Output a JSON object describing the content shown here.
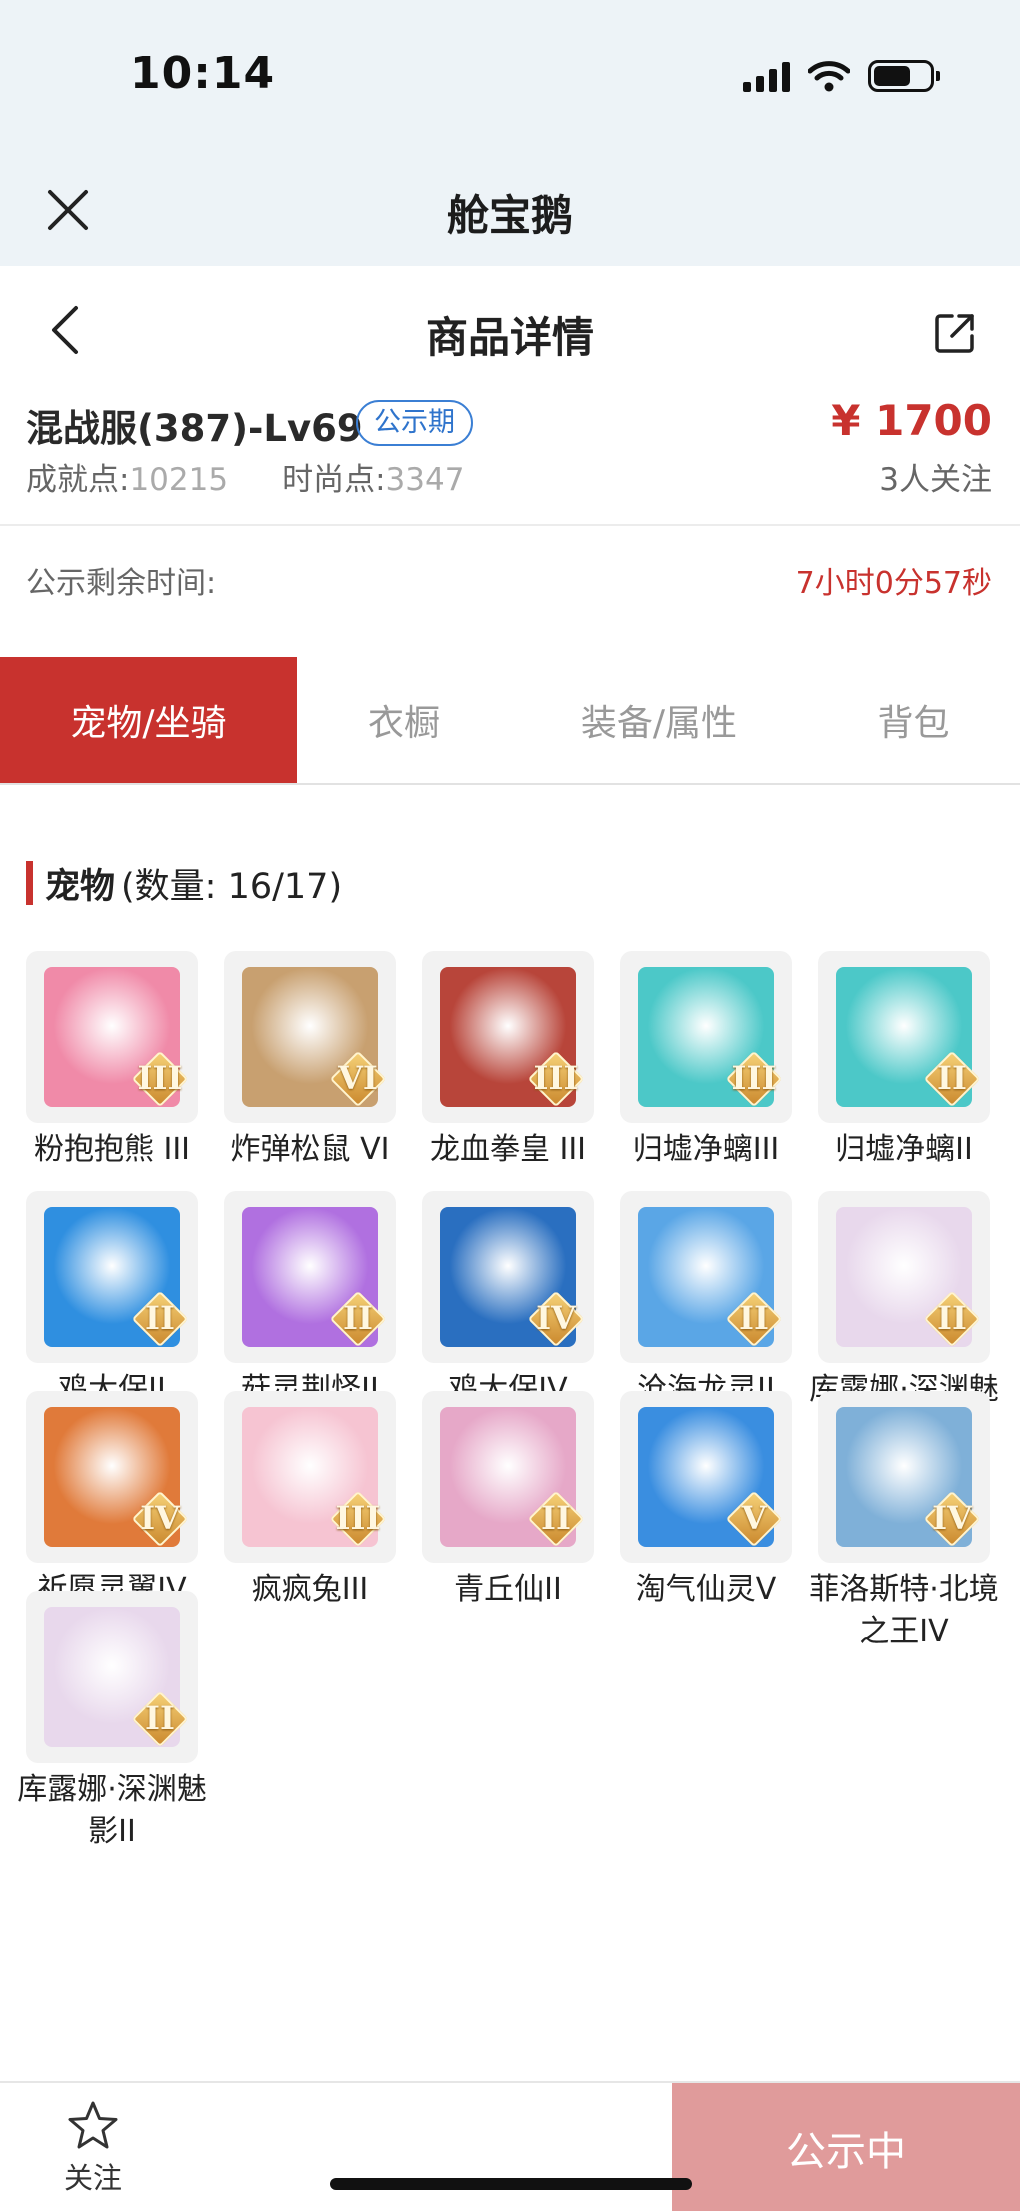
{
  "status_bar": {
    "time": "10:14"
  },
  "miniprogram": {
    "title": "舱宝鹅",
    "close_icon": "close-icon"
  },
  "header": {
    "title": "商品详情",
    "back_icon": "chevron-left-icon",
    "share_icon": "share-icon"
  },
  "product": {
    "name": "混战服(387)-Lv69",
    "status_tag": "公示期",
    "price": "¥ 1700",
    "achievement_label": "成就点:",
    "achievement_value": "10215",
    "fashion_label": "时尚点:",
    "fashion_value": "3347",
    "followers": "3人关注"
  },
  "countdown": {
    "label": "公示剩余时间:",
    "value": "7小时0分57秒"
  },
  "tabs": [
    {
      "label": "宠物/坐骑",
      "active": true
    },
    {
      "label": "衣橱",
      "active": false
    },
    {
      "label": "装备/属性",
      "active": false
    },
    {
      "label": "背包",
      "active": false
    }
  ],
  "pets_section": {
    "title": "宠物",
    "count": "(数量: 16/17)"
  },
  "pets": [
    {
      "name": "粉抱抱熊 III",
      "badge": "III",
      "color": "#f08aa8"
    },
    {
      "name": "炸弹松鼠 VI",
      "badge": "VI",
      "color": "#c8a070"
    },
    {
      "name": "龙血拳皇 III",
      "badge": "III",
      "color": "#b8453a"
    },
    {
      "name": "归墟净螭III",
      "badge": "III",
      "color": "#4cc8c8"
    },
    {
      "name": "归墟净螭II",
      "badge": "II",
      "color": "#4cc8c8"
    },
    {
      "name": "鸡大保II",
      "badge": "II",
      "color": "#2f8fe0"
    },
    {
      "name": "菇灵荆怪II",
      "badge": "II",
      "color": "#b070e0"
    },
    {
      "name": "鸡大保IV",
      "badge": "IV",
      "color": "#2a6fc0"
    },
    {
      "name": "沧海龙灵II",
      "badge": "II",
      "color": "#5aa6e6"
    },
    {
      "name": "库露娜·深渊魅影II",
      "badge": "II",
      "color": "#e8d8ec"
    },
    {
      "name": "祈愿灵翼IV",
      "badge": "IV",
      "color": "#e07a3a"
    },
    {
      "name": "疯疯兔III",
      "badge": "III",
      "color": "#f6c4d2"
    },
    {
      "name": "青丘仙II",
      "badge": "II",
      "color": "#e6a8c8"
    },
    {
      "name": "淘气仙灵V",
      "badge": "V",
      "color": "#3a8ee0"
    },
    {
      "name": "菲洛斯特·北境之王IV",
      "badge": "IV",
      "color": "#7fb0d8"
    },
    {
      "name": "库露娜·深渊魅影II",
      "badge": "II",
      "color": "#e8d8ec"
    }
  ],
  "bottom_bar": {
    "follow_label": "关注",
    "follow_icon": "star-icon",
    "status_button": "公示中"
  }
}
